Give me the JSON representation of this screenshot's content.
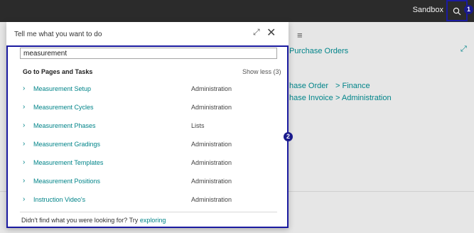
{
  "topbar": {
    "environment": "Sandbox",
    "badge1": "1"
  },
  "background": {
    "page_title": "Purchase Orders",
    "links": [
      "hase Order",
      "> Finance",
      "hase Invoice",
      "> Administration"
    ]
  },
  "dialog": {
    "title": "Tell me what you want to do",
    "search": {
      "value": "measurement"
    },
    "section_title": "Go to Pages and Tasks",
    "show_less": "Show less (3)",
    "results": [
      {
        "name": "Measurement Setup",
        "category": "Administration"
      },
      {
        "name": "Measurement Cycles",
        "category": "Administration"
      },
      {
        "name": "Measurement Phases",
        "category": "Lists"
      },
      {
        "name": "Measurement Gradings",
        "category": "Administration"
      },
      {
        "name": "Measurement Templates",
        "category": "Administration"
      },
      {
        "name": "Measurement Positions",
        "category": "Administration"
      },
      {
        "name": "Instruction Video's",
        "category": "Administration"
      }
    ],
    "footer_text": "Didn't find what you were looking for? Try",
    "footer_link": "exploring",
    "badge2": "2"
  },
  "icons": {
    "search": "search-icon",
    "close": "close-icon",
    "expand": "expand-icon",
    "menu": "hamburger-icon",
    "chevron": "chevron-right-icon"
  },
  "colors": {
    "accent": "#008489",
    "focus": "#1b1ba0",
    "topbar": "#2b2b2b"
  }
}
